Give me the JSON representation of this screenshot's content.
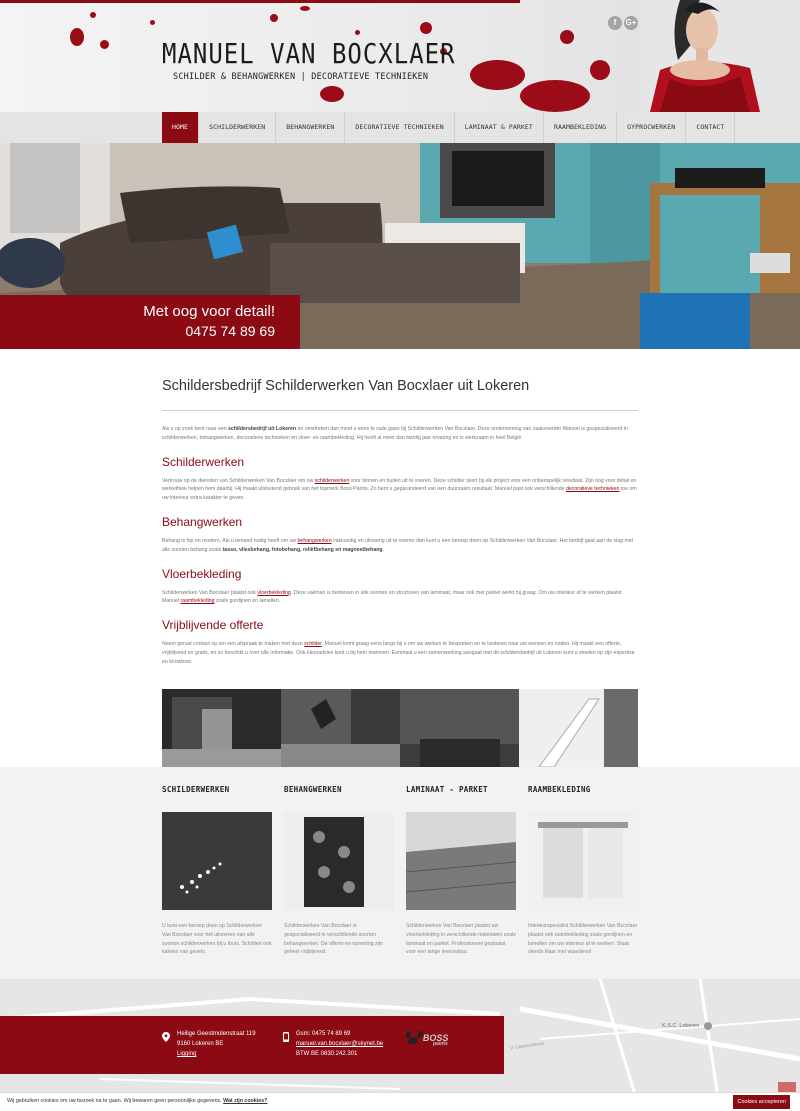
{
  "header": {
    "title": "MANUEL VAN BOCXLAER",
    "subtitle": "SCHILDER & BEHANGWERKEN | DECORATIEVE TECHNIEKEN",
    "social": [
      {
        "icon": "facebook-icon",
        "glyph": "f"
      },
      {
        "icon": "google-plus-icon",
        "glyph": "G+"
      }
    ]
  },
  "nav": {
    "items": [
      "HOME",
      "SCHILDERWERKEN",
      "BEHANGWERKEN",
      "DECORATIEVE TECHNIEKEN",
      "LAMINAAT & PARKET",
      "RAAMBEKLEDING",
      "GYPROCWERKEN",
      "CONTACT"
    ],
    "active": "HOME"
  },
  "hero": {
    "tagline": "Met oog voor detail!",
    "phone": "0475 74 89 69"
  },
  "main": {
    "title": "Schildersbedrijf Schilderwerken Van Bocxlaer uit Lokeren",
    "intro": {
      "p1": "Als u op zoek bent naar een ",
      "b1": "schildersbedrijf uit Lokeren",
      "p2": " en omstreken dan moet u eens te rade gaan bij Schilderwerken Van Bocxlaer. Deze onderneming van zaakvoerder Manuel is gespecialiseerd in schilderwerken, behangwerken, decoratieve technieken en vloer- en raambekleding. Hij heeft al meer dan twintig jaar ervaring en is werkzaam in heel België."
    },
    "schilderwerken": {
      "heading": "Schilderwerken",
      "p1": "Vertrouw op de diensten van Schilderwerken Van Bocxlaer om uw ",
      "link1": "schilderwerken",
      "p2": " voor binnen en buiten uit te voeren. Deze schilder ijvert bij elk project voor een onberispelijk resultaat. Zijn oog voor detail en werkethiek helpen hem daarbij. Hij maakt uitsluitend gebruik van het topmerk Boss Paints. Zo bent u gegarandeerd van een duurzaam resultaat. Manuel past ook verschillende ",
      "link2": "decoratieve technieken",
      "p3": " toe om uw interieur extra karakter te geven."
    },
    "behangwerken": {
      "heading": "Behangwerken",
      "p1": "Behang is hip en modern. Als u iemand nodig heeft om uw ",
      "link1": "behangwerken",
      "p2": " vakkundig en uitvoerig uit te voeren dan kunt u een beroep doen op Schilderwerken Van Bocxlaer. Het bedrijf gaat aan de slag met alle soorten behang zoals ",
      "b1": "tasso, vliesbehang, fotobehang, reliëfbehang en magneetbehang",
      "p3": "."
    },
    "vloerbekleding": {
      "heading": "Vloerbekleding",
      "p1": "Schilderwerken Van Bocxlaer plaatst ook ",
      "link1": "vloerbekleding",
      "p2": ". Deze vakman is bedreven in alle soorten en structuren van laminaat, maar ook met parket werkt hij graag. Om uw interieur af te werken plaatst Manuel ",
      "link2": "raambekleding",
      "p3": " zoals gordijnen en lamellen."
    },
    "offerte": {
      "heading": "Vrijblijvende offerte",
      "p1": "Neem gerust contact op om een afspraak te maken met deze ",
      "link1": "schilder",
      "p2": ". Manuel komt graag eens langs bij u om uw werken te bespreken en te luisteren naar uw wensen en noden. Hij maakt een offerte, vrijblijvend en gratis, en zo beschikt u over alle informatie. Ook kleuradvies kunt u bij hem inwinnen. Eenmaal u een samenwerking aangaat met dit schildersbedrijf uit Lokeren kunt u stoelen op zijn expertise en knowhow."
    }
  },
  "services": [
    {
      "title": "SCHILDERWERKEN",
      "text": "U kunt een beroep doen op Schilderwerken Van Bocxlaer voor het uitvoeren van alle soorten schilderwerken bij u thuis. Schildert ook kaleien van gevels."
    },
    {
      "title": "BEHANGWERKEN",
      "text": "Schilderwerken Van Bocxlaer is gespecialiseerd in verschillende soorten behangwerken. De offerte en opmeting zijn geheel vrijblijvend."
    },
    {
      "title": "LAMINAAT - PARKET",
      "text": "Schilderwerken Van Bocxlaer plaatst uw vloerbekleding in verschillende materialen zoals laminaat en parket. Professioneel geplaatst voor een lange levensduur."
    },
    {
      "title": "RAAMBEKLEDING",
      "text": "Interieurspecialist Schilderwerken Van Bocxlaer plaatst ook raambekleding zoals gordijnen en lamellen om uw interieur af te werken. Staat steeds klaar met waardevol"
    }
  ],
  "footer": {
    "address1": "Heilige Geestmolenstraat 119",
    "address2": "9160 Lokeren BE",
    "ligging": "Ligging",
    "gsm": "Gsm: 0475 74 89 69",
    "email": "manuel.van.bocxlaer@skynet.be",
    "btw": "BTW BE 0830.242.301",
    "boss": "BOSS",
    "boss_sub": "paints"
  },
  "map": {
    "label1": "K.S.C. Lokeren",
    "label2": "V. Gasthuisstraat"
  },
  "cookie": {
    "text": "Wij gebruiken cookies om uw bezoek na te gaan. Wij bewaren geen persoonlijke gegevens.",
    "link": "Wat zijn cookies?",
    "button": "Cookies accepteren"
  },
  "colors": {
    "accent": "#8b0a14",
    "nav_bg": "#e4e4e4",
    "services_bg": "#f2f2f2"
  }
}
